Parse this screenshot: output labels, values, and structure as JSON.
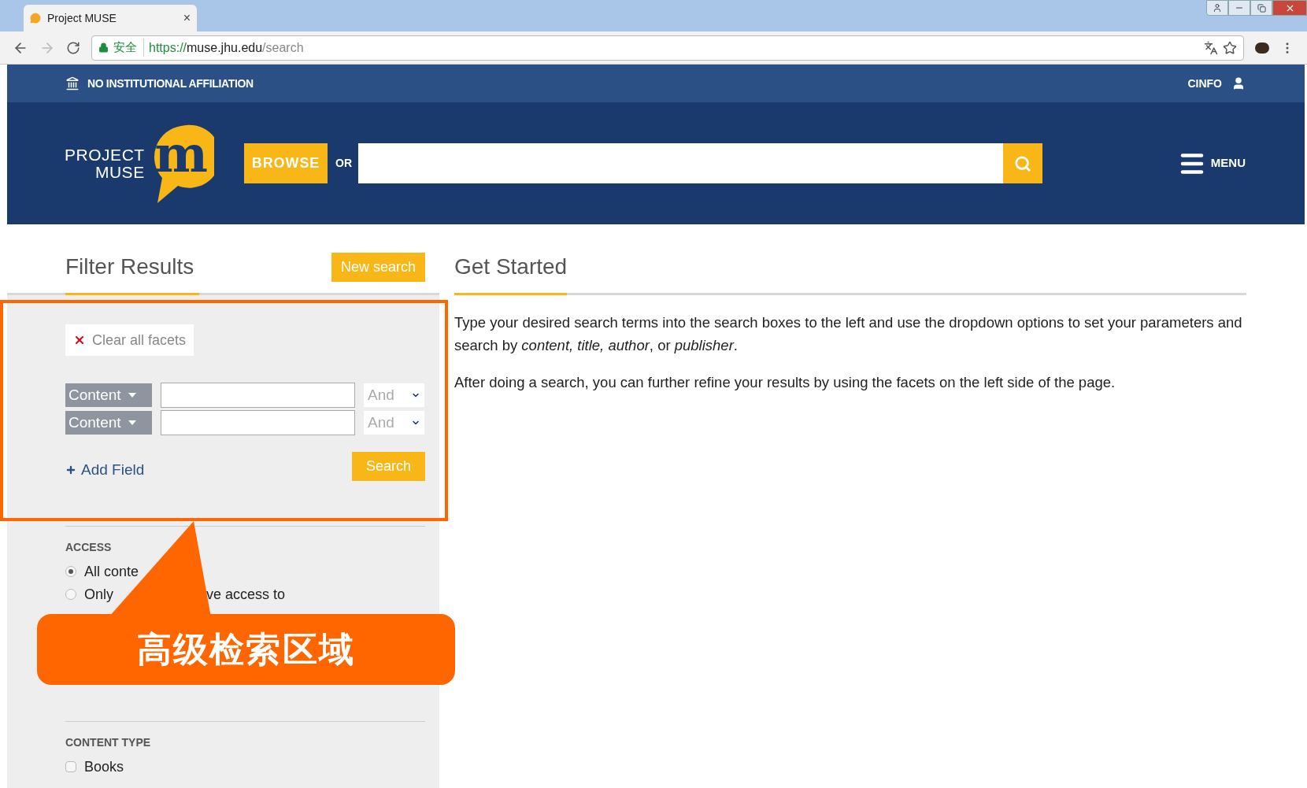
{
  "browser": {
    "tab_title": "Project MUSE",
    "tab_close": "×",
    "secure_label": "安全",
    "scheme": "https://",
    "host": "muse.jhu.edu",
    "path": "/search"
  },
  "top_bar": {
    "affiliation": "NO INSTITUTIONAL AFFILIATION",
    "user": "CINFO"
  },
  "header": {
    "logo_line_1": "PROJECT",
    "logo_line_2": "MUSE",
    "logo_mark": "m",
    "browse": "BROWSE",
    "or": "OR",
    "menu": "MENU"
  },
  "filter": {
    "title": "Filter Results",
    "new_search": "New search",
    "clear": "Clear all facets",
    "rows": [
      {
        "field": "Content",
        "operator": "And"
      },
      {
        "field": "Content",
        "operator": "And"
      }
    ],
    "add_field": "Add Field",
    "search": "Search"
  },
  "facets": [
    {
      "title": "ACCESS",
      "options": [
        {
          "kind": "radio",
          "parts": [
            "All conte"
          ],
          "selected": true
        },
        {
          "kind": "radio",
          "parts": [
            "Only",
            "ve access to"
          ],
          "selected": false
        }
      ]
    },
    {
      "title": "CONTENT TYPE",
      "options": [
        {
          "kind": "checkbox",
          "parts": [
            "Books"
          ],
          "checked": false
        }
      ]
    }
  ],
  "main": {
    "title": "Get Started",
    "paragraphs": [
      "Type your desired search terms into the search boxes to the left and use the dropdown options to set your parameters and search by *content, title, author*, or *publisher*.",
      "After doing a search, you can further refine your results by using the facets on the left side of the page."
    ]
  },
  "annotation": {
    "label": "高级检索区域"
  }
}
